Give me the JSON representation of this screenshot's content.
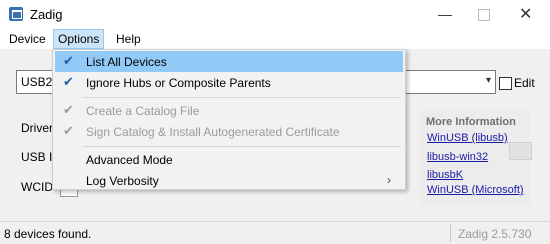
{
  "window": {
    "title": "Zadig"
  },
  "menubar": {
    "device": "Device",
    "options": "Options",
    "help": "Help"
  },
  "device_combo": {
    "value": "USB2.0"
  },
  "edit_label": "Edit",
  "labels": {
    "driver": "Driver",
    "usb_id": "USB ID",
    "wcid": "WCID"
  },
  "info": {
    "title": "More Information",
    "links": [
      "WinUSB (libusb)",
      "libusb-win32",
      "libusbK",
      "WinUSB (Microsoft)"
    ]
  },
  "status": {
    "text": "8 devices found.",
    "version": "Zadig 2.5.730"
  },
  "options_menu": {
    "items": [
      {
        "label": "List All Devices",
        "checked": true
      },
      {
        "label": "Ignore Hubs or Composite Parents",
        "checked": true
      },
      {
        "label": "Create a Catalog File",
        "checked": true,
        "disabled": true
      },
      {
        "label": "Sign Catalog & Install Autogenerated Certificate",
        "checked": true,
        "disabled": true
      },
      {
        "label": "Advanced Mode",
        "checked": false
      },
      {
        "label": "Log Verbosity",
        "checked": false,
        "submenu": true
      }
    ]
  },
  "colors": {
    "highlight": "#91c9f7",
    "link": "#1a1aa6",
    "check": "#1f5fa8"
  }
}
